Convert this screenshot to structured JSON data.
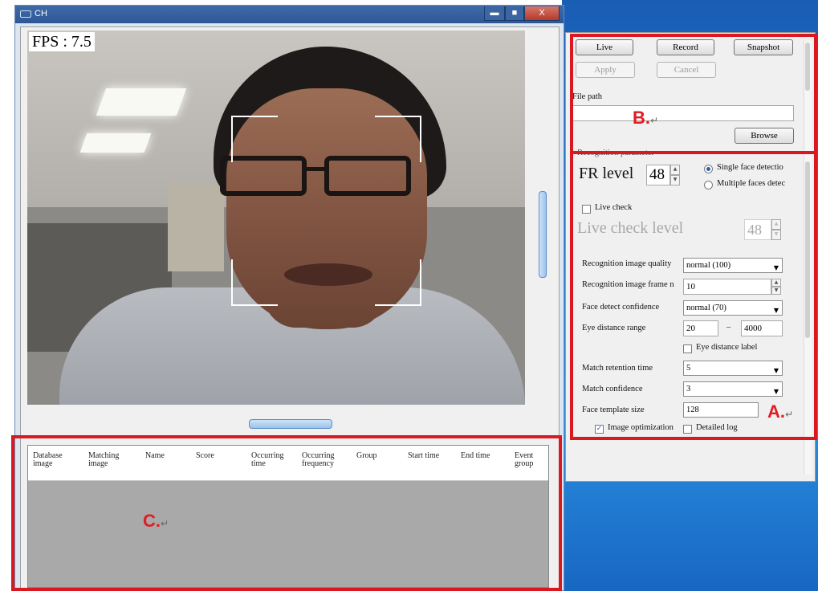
{
  "window": {
    "title": "CH",
    "minimize": "▬",
    "maximize": "■",
    "close": "X"
  },
  "camera": {
    "fps_label": "FPS : 7.5"
  },
  "controls": {
    "live_label": "Live",
    "record_label": "Record",
    "snapshot_label": "Snapshot",
    "apply_label": "Apply",
    "cancel_label": "Cancel",
    "file_path_label": "File path",
    "file_path_value": "",
    "browse_label": "Browse"
  },
  "recognition": {
    "group_label": "Recognition parameter",
    "fr_level_label": "FR level",
    "fr_level_value": "48",
    "single_face_label": "Single face detectio",
    "multiple_faces_label": "Multiple faces detec",
    "live_check_label": "Live check",
    "live_check_level_label": "Live check level",
    "live_check_level_value": "48",
    "image_quality_label": "Recognition image quality",
    "image_quality_value": "normal (100)",
    "frame_label": "Recognition image frame n",
    "frame_value": "10",
    "face_detect_conf_label": "Face detect confidence",
    "face_detect_conf_value": "normal (70)",
    "eye_distance_label": "Eye distance range",
    "eye_distance_min": "20",
    "eye_distance_dash": "–",
    "eye_distance_max": "4000",
    "eye_distance_label_checkbox": "Eye distance label",
    "match_retention_label": "Match retention time",
    "match_retention_value": "5",
    "match_confidence_label": "Match confidence",
    "match_confidence_value": "3",
    "template_size_label": "Face template size",
    "template_size_value": "128",
    "image_optimization_label": "Image optimization",
    "detailed_log_label": "Detailed log",
    "spin_up": "▲",
    "spin_down": "▼",
    "dropdown_arrow": "▼",
    "check_mark": "✓"
  },
  "results_table": {
    "columns": [
      "Database image",
      "Matching image",
      "Name",
      "Score",
      "Occurring time",
      "Occurring frequency",
      "Group",
      "Start time",
      "End time",
      "Event group"
    ]
  },
  "annotations": {
    "a": "A.",
    "b": "B.",
    "c": "C.",
    "return_mark": "↵"
  },
  "colors": {
    "annotation_red": "#d9191f",
    "titlebar_blue": "#2e5796",
    "desktop_blue": "#1f7ad0",
    "table_gray": "#a9a9a9"
  }
}
